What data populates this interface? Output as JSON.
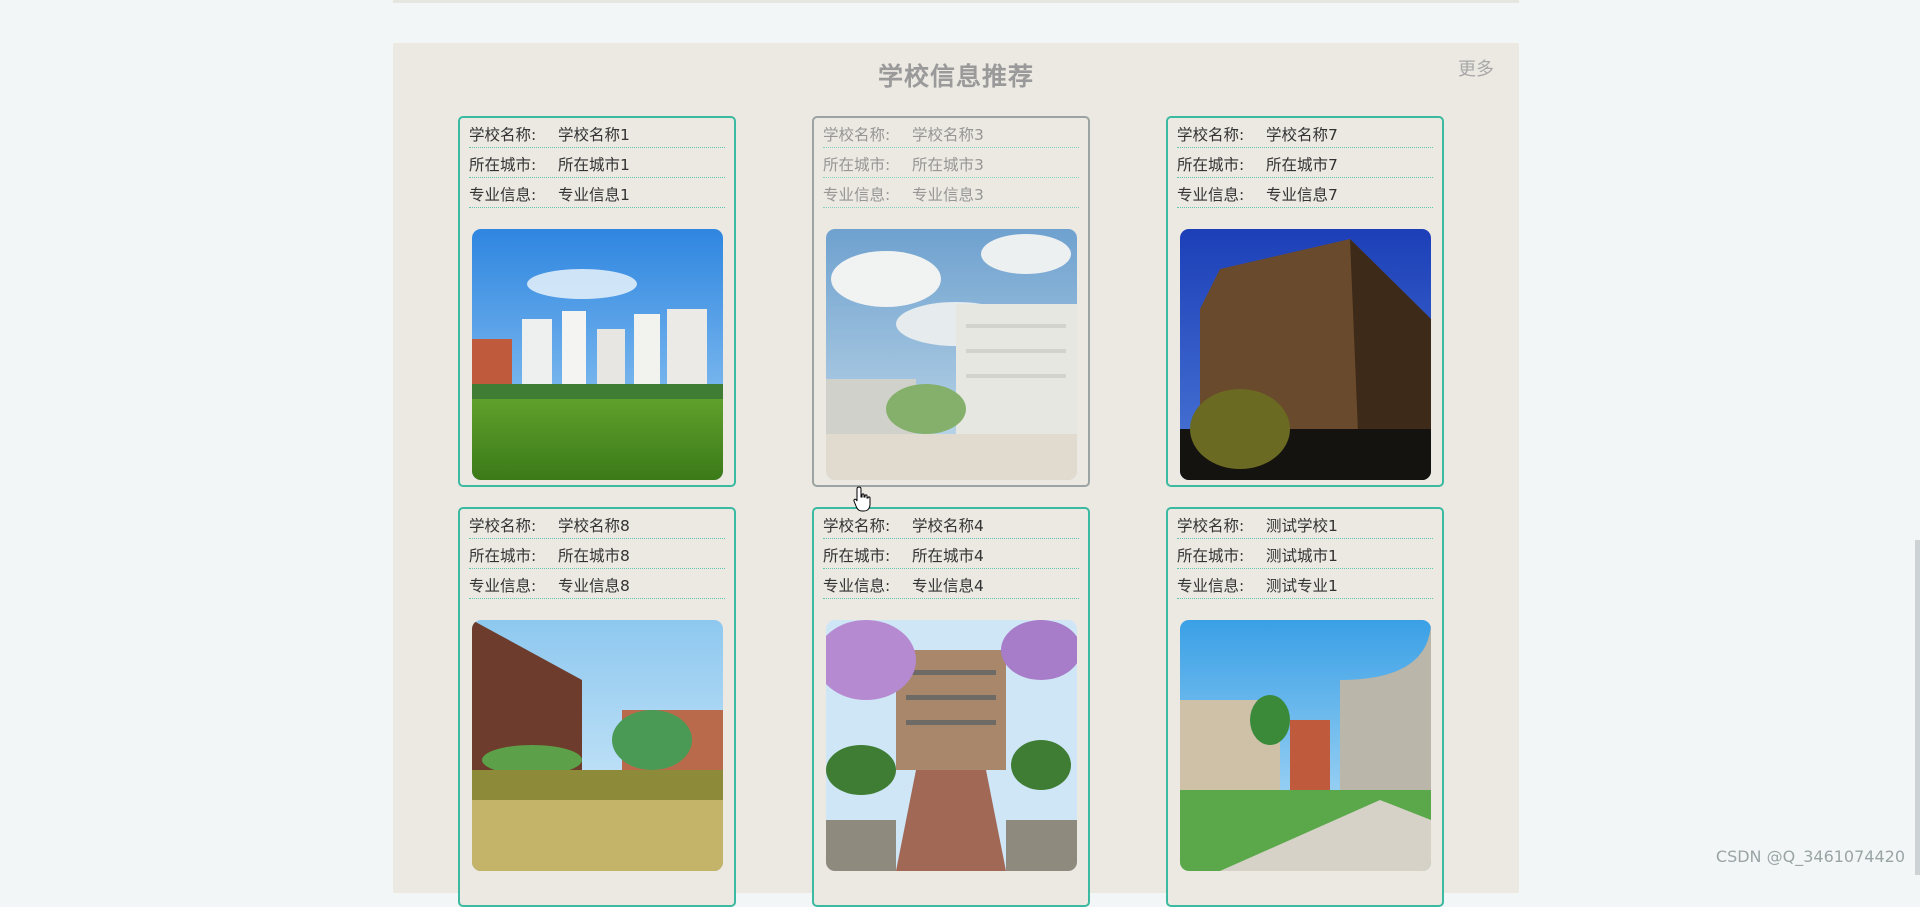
{
  "section": {
    "title": "学校信息推荐",
    "more_label": "更多"
  },
  "field_labels": {
    "name": "学校名称:",
    "city": "所在城市:",
    "major": "专业信息:"
  },
  "cards": [
    {
      "name": "学校名称1",
      "city": "所在城市1",
      "major": "专业信息1",
      "image": "campus-buildings-lawn"
    },
    {
      "name": "学校名称3",
      "city": "所在城市3",
      "major": "专业信息3",
      "image": "campus-sky-building",
      "state": "hovered"
    },
    {
      "name": "学校名称7",
      "city": "所在城市7",
      "major": "专业信息7",
      "image": "brick-building-night"
    },
    {
      "name": "学校名称8",
      "city": "所在城市8",
      "major": "专业信息8",
      "image": "campus-lake-reflection"
    },
    {
      "name": "学校名称4",
      "city": "所在城市4",
      "major": "专业信息4",
      "image": "school-gate-blossoms"
    },
    {
      "name": "测试学校1",
      "city": "测试城市1",
      "major": "测试专业1",
      "image": "curved-building-courtyard"
    }
  ],
  "watermark": "CSDN @Q_3461074420",
  "colors": {
    "accent": "#3cbaa1",
    "section_bg": "#ece9e3",
    "page_bg": "#f2f6f6"
  }
}
